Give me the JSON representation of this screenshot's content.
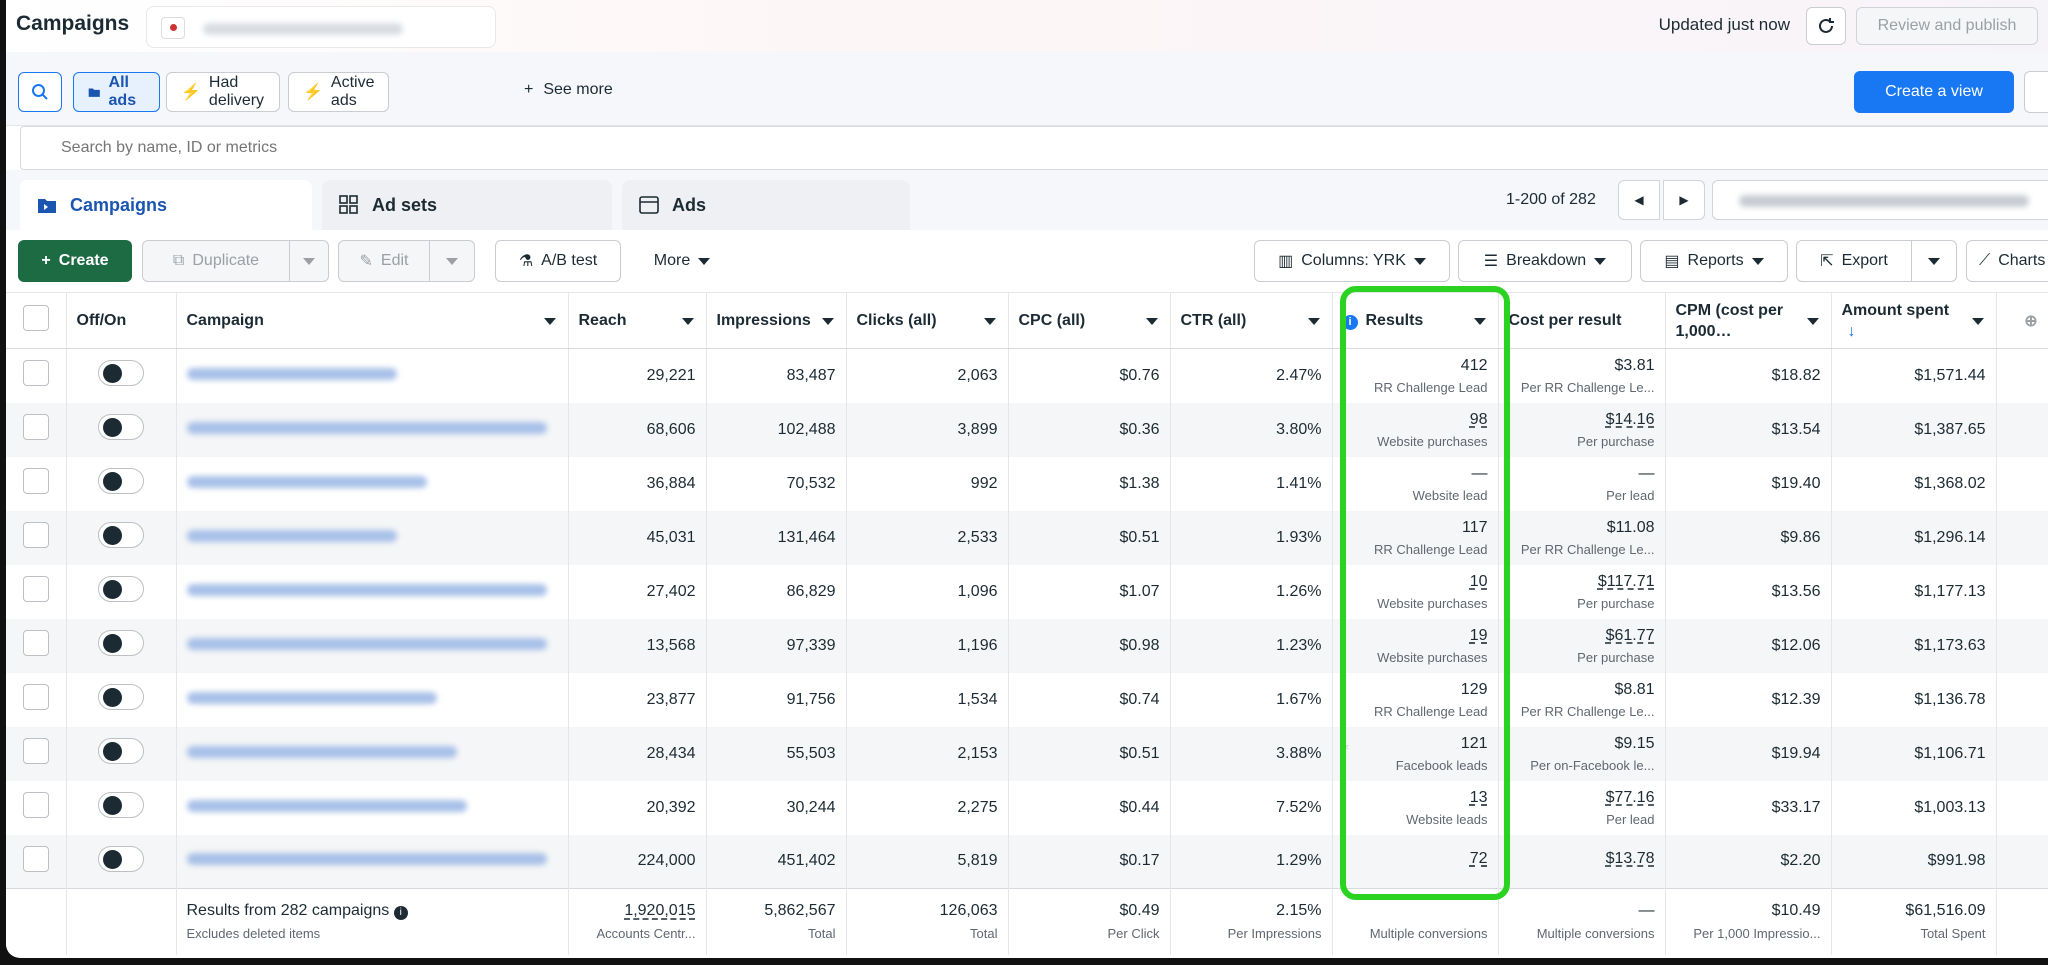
{
  "topbar": {
    "title": "Campaigns",
    "updated": "Updated just now",
    "review_publish": "Review and publish"
  },
  "filters": {
    "all_ads": "All ads",
    "had_delivery": "Had delivery",
    "active_ads": "Active ads",
    "see_more": "See more",
    "create_view": "Create a view"
  },
  "search": {
    "placeholder": "Search by name, ID or metrics"
  },
  "tabs": [
    {
      "label": "Campaigns"
    },
    {
      "label": "Ad sets"
    },
    {
      "label": "Ads"
    }
  ],
  "pager": {
    "range": "1-200 of 282"
  },
  "toolbar": {
    "create": "Create",
    "duplicate": "Duplicate",
    "edit": "Edit",
    "ab_test": "A/B test",
    "more": "More",
    "columns": "Columns: YRK",
    "breakdown": "Breakdown",
    "reports": "Reports",
    "export": "Export",
    "charts": "Charts"
  },
  "table": {
    "headers": {
      "offon": "Off/On",
      "campaign": "Campaign",
      "reach": "Reach",
      "impressions": "Impressions",
      "clicks": "Clicks (all)",
      "cpc": "CPC (all)",
      "ctr": "CTR (all)",
      "results": "Results",
      "cost_per_result": "Cost per result",
      "cpm_line1": "CPM (cost per",
      "cpm_line2": "1,000…",
      "amount_spent": "Amount spent"
    },
    "rows": [
      {
        "reach": "29,221",
        "impressions": "83,487",
        "clicks": "2,063",
        "cpc": "$0.76",
        "ctr": "2.47%",
        "results": "412",
        "results_sub": "RR Challenge Lead",
        "cpr": "$3.81",
        "cpr_sub": "Per RR Challenge Le...",
        "cpm": "$18.82",
        "spent": "$1,571.44"
      },
      {
        "reach": "68,606",
        "impressions": "102,488",
        "clicks": "3,899",
        "cpc": "$0.36",
        "ctr": "3.80%",
        "results": "98",
        "results_sub": "Website purchases",
        "cpr": "$14.16",
        "cpr_sub": "Per purchase",
        "cpm": "$13.54",
        "spent": "$1,387.65"
      },
      {
        "reach": "36,884",
        "impressions": "70,532",
        "clicks": "992",
        "cpc": "$1.38",
        "ctr": "1.41%",
        "results": "—",
        "results_sub": "Website lead",
        "cpr": "—",
        "cpr_sub": "Per lead",
        "cpm": "$19.40",
        "spent": "$1,368.02"
      },
      {
        "reach": "45,031",
        "impressions": "131,464",
        "clicks": "2,533",
        "cpc": "$0.51",
        "ctr": "1.93%",
        "results": "117",
        "results_sub": "RR Challenge Lead",
        "cpr": "$11.08",
        "cpr_sub": "Per RR Challenge Le...",
        "cpm": "$9.86",
        "spent": "$1,296.14"
      },
      {
        "reach": "27,402",
        "impressions": "86,829",
        "clicks": "1,096",
        "cpc": "$1.07",
        "ctr": "1.26%",
        "results": "10",
        "results_sub": "Website purchases",
        "cpr": "$117.71",
        "cpr_sub": "Per purchase",
        "cpm": "$13.56",
        "spent": "$1,177.13"
      },
      {
        "reach": "13,568",
        "impressions": "97,339",
        "clicks": "1,196",
        "cpc": "$0.98",
        "ctr": "1.23%",
        "results": "19",
        "results_sub": "Website purchases",
        "cpr": "$61.77",
        "cpr_sub": "Per purchase",
        "cpm": "$12.06",
        "spent": "$1,173.63"
      },
      {
        "reach": "23,877",
        "impressions": "91,756",
        "clicks": "1,534",
        "cpc": "$0.74",
        "ctr": "1.67%",
        "results": "129",
        "results_sub": "RR Challenge Lead",
        "cpr": "$8.81",
        "cpr_sub": "Per RR Challenge Le...",
        "cpm": "$12.39",
        "spent": "$1,136.78"
      },
      {
        "reach": "28,434",
        "impressions": "55,503",
        "clicks": "2,153",
        "cpc": "$0.51",
        "ctr": "3.88%",
        "results": "121",
        "results_sub": "Facebook leads",
        "cpr": "$9.15",
        "cpr_sub": "Per on-Facebook le...",
        "cpm": "$19.94",
        "spent": "$1,106.71"
      },
      {
        "reach": "20,392",
        "impressions": "30,244",
        "clicks": "2,275",
        "cpc": "$0.44",
        "ctr": "7.52%",
        "results": "13",
        "results_sub": "Website leads",
        "cpr": "$77.16",
        "cpr_sub": "Per lead",
        "cpm": "$33.17",
        "spent": "$1,003.13"
      },
      {
        "reach": "224,000",
        "impressions": "451,402",
        "clicks": "5,819",
        "cpc": "$0.17",
        "ctr": "1.29%",
        "results": "72",
        "results_sub": "",
        "cpr": "$13.78",
        "cpr_sub": "",
        "cpm": "$2.20",
        "spent": "$991.98"
      }
    ],
    "footer": {
      "label": "Results from 282 campaigns",
      "label_sub": "Excludes deleted items",
      "reach": "1,920,015",
      "reach_sub": "Accounts Centr...",
      "impressions": "5,862,567",
      "impressions_sub": "Total",
      "clicks": "126,063",
      "clicks_sub": "Total",
      "cpc": "$0.49",
      "cpc_sub": "Per Click",
      "ctr": "2.15%",
      "ctr_sub": "Per Impressions",
      "results_sub": "Multiple conversions",
      "cpr": "—",
      "cpr_sub": "Multiple conversions",
      "cpm": "$10.49",
      "cpm_sub": "Per 1,000 Impressio...",
      "spent": "$61,516.09",
      "spent_sub": "Total Spent"
    }
  },
  "colors": {
    "accent": "#1877f2",
    "create_green": "#1d6b43",
    "highlight": "#2bd321"
  }
}
